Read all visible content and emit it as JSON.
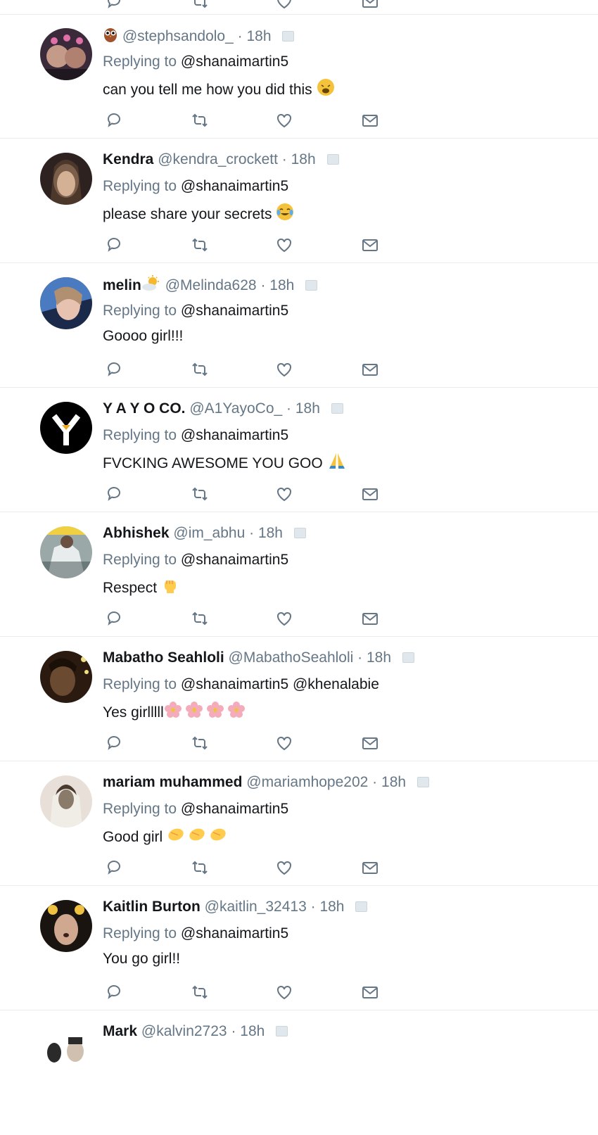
{
  "common": {
    "replying_prefix": "Replying to",
    "dot": "·"
  },
  "tweets": [
    {
      "name": "",
      "handle": "@stephsandolo_",
      "time": "18h",
      "mentions": "@shanaimartin5",
      "text": "can you tell me how you did this",
      "name_emoji": "owl-emoji",
      "text_emoji": "weary-face-emoji",
      "avatar_colors": [
        "#3a2a3a",
        "#b88a8a",
        "#d86fa0"
      ]
    },
    {
      "name": "Kendra",
      "handle": "@kendra_crockett",
      "time": "18h",
      "mentions": "@shanaimartin5",
      "text": "please share your secrets",
      "text_emoji": "tears-of-joy-emoji",
      "avatar_colors": [
        "#2d2220",
        "#8a6a55",
        "#c9a78a"
      ]
    },
    {
      "name": "melin",
      "handle": "@Melinda628",
      "time": "18h",
      "mentions": "@shanaimartin5",
      "text": "Goooo girl!!!",
      "name_emoji": "sun-behind-cloud-emoji",
      "avatar_colors": [
        "#1b2a4a",
        "#5a8ad0",
        "#e8c2b0"
      ]
    },
    {
      "name": "Y A Y O CO.",
      "handle": "@A1YayoCo_",
      "time": "18h",
      "mentions": "@shanaimartin5",
      "text": "FVCKING AWESOME YOU GOO",
      "text_emoji": "folded-hands-emoji",
      "avatar_colors": [
        "#000000",
        "#ffffff",
        "#f0a820"
      ]
    },
    {
      "name": "Abhishek",
      "handle": "@im_abhu",
      "time": "18h",
      "mentions": "@shanaimartin5",
      "text": "Respect",
      "text_emoji": "raised-fist-emoji",
      "avatar_colors": [
        "#7a8a8a",
        "#c8d0d0",
        "#3a4a4a"
      ]
    },
    {
      "name": "Mabatho Seahloli",
      "handle": "@MabathoSeahloli",
      "time": "18h",
      "mentions": "@shanaimartin5 @khenalabie",
      "text": "Yes girlllll",
      "text_emoji": "cherry-blossom-emoji-x4",
      "avatar_colors": [
        "#2a1a10",
        "#6a4a30",
        "#c0a050"
      ]
    },
    {
      "name": "mariam muhammed",
      "handle": "@mariamhope202",
      "time": "18h",
      "mentions": "@shanaimartin5",
      "text": "Good girl",
      "text_emoji": "clapping-hands-emoji-x3",
      "avatar_colors": [
        "#d8d0c8",
        "#8a7a6a",
        "#f0ece6"
      ]
    },
    {
      "name": "Kaitlin Burton",
      "handle": "@kaitlin_32413",
      "time": "18h",
      "mentions": "@shanaimartin5",
      "text": "You go girl!!",
      "avatar_colors": [
        "#1a1410",
        "#d0a890",
        "#f0c040"
      ]
    },
    {
      "name": "Mark",
      "handle": "@kalvin2723",
      "time": "18h",
      "mentions": "",
      "text": "",
      "avatar_colors": [
        "#2a2a2a",
        "#d0c0b0",
        "#ffffff"
      ]
    }
  ]
}
